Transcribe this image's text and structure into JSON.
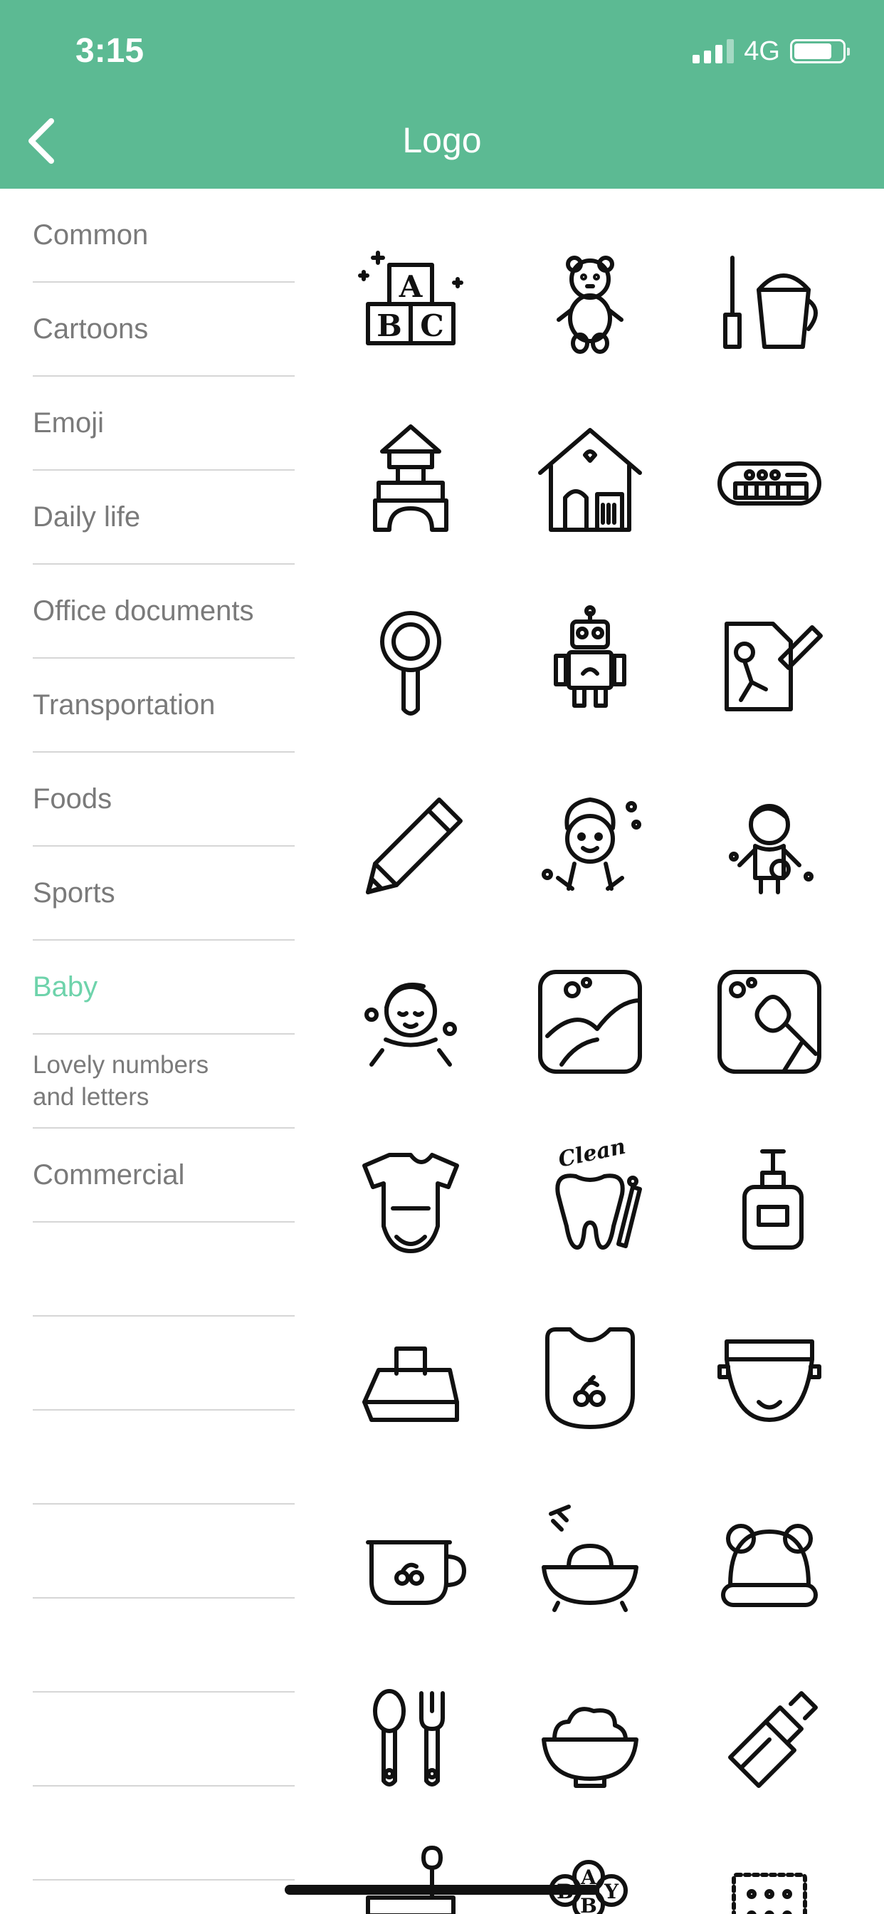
{
  "status_bar": {
    "time": "3:15",
    "network": "4G"
  },
  "header": {
    "title": "Logo"
  },
  "colors": {
    "header_bg": "#5cba93",
    "active_category": "#6ed3ab",
    "category_text": "#7a7a7a"
  },
  "categories": [
    {
      "label": "Common",
      "active": false
    },
    {
      "label": "Cartoons",
      "active": false
    },
    {
      "label": "Emoji",
      "active": false
    },
    {
      "label": "Daily life",
      "active": false
    },
    {
      "label": "Office documents",
      "active": false
    },
    {
      "label": "Transportation",
      "active": false
    },
    {
      "label": "Foods",
      "active": false
    },
    {
      "label": "Sports",
      "active": false
    },
    {
      "label": "Baby",
      "active": true
    },
    {
      "label": "Lovely numbers\nand letters",
      "active": false
    },
    {
      "label": "Commercial",
      "active": false
    }
  ],
  "icons": [
    "abc-blocks-icon",
    "teddy-bear-icon",
    "sand-bucket-shovel-icon",
    "toy-castle-icon",
    "toy-house-icon",
    "toy-piano-icon",
    "rattle-icon",
    "robot-icon",
    "drawing-paper-icon",
    "pencil-icon",
    "bathing-child-icon",
    "soaping-child-icon",
    "relaxed-baby-icon",
    "bathtub-tile-icon",
    "scrub-tile-icon",
    "onesie-icon",
    "clean-tooth-icon",
    "lotion-bottle-icon",
    "baby-wipes-icon",
    "bib-icon",
    "diaper-icon",
    "sippy-cup-icon",
    "baby-bath-icon",
    "bear-hat-icon",
    "spoon-fork-icon",
    "food-bowl-icon",
    "baby-bottle-icon",
    "potty-icon",
    "baby-balloons-icon",
    "cracker-icon"
  ],
  "icon_text": {
    "abc": [
      "A",
      "B",
      "C"
    ],
    "clean": "Clean",
    "baby": [
      "B",
      "A",
      "B",
      "Y"
    ]
  }
}
